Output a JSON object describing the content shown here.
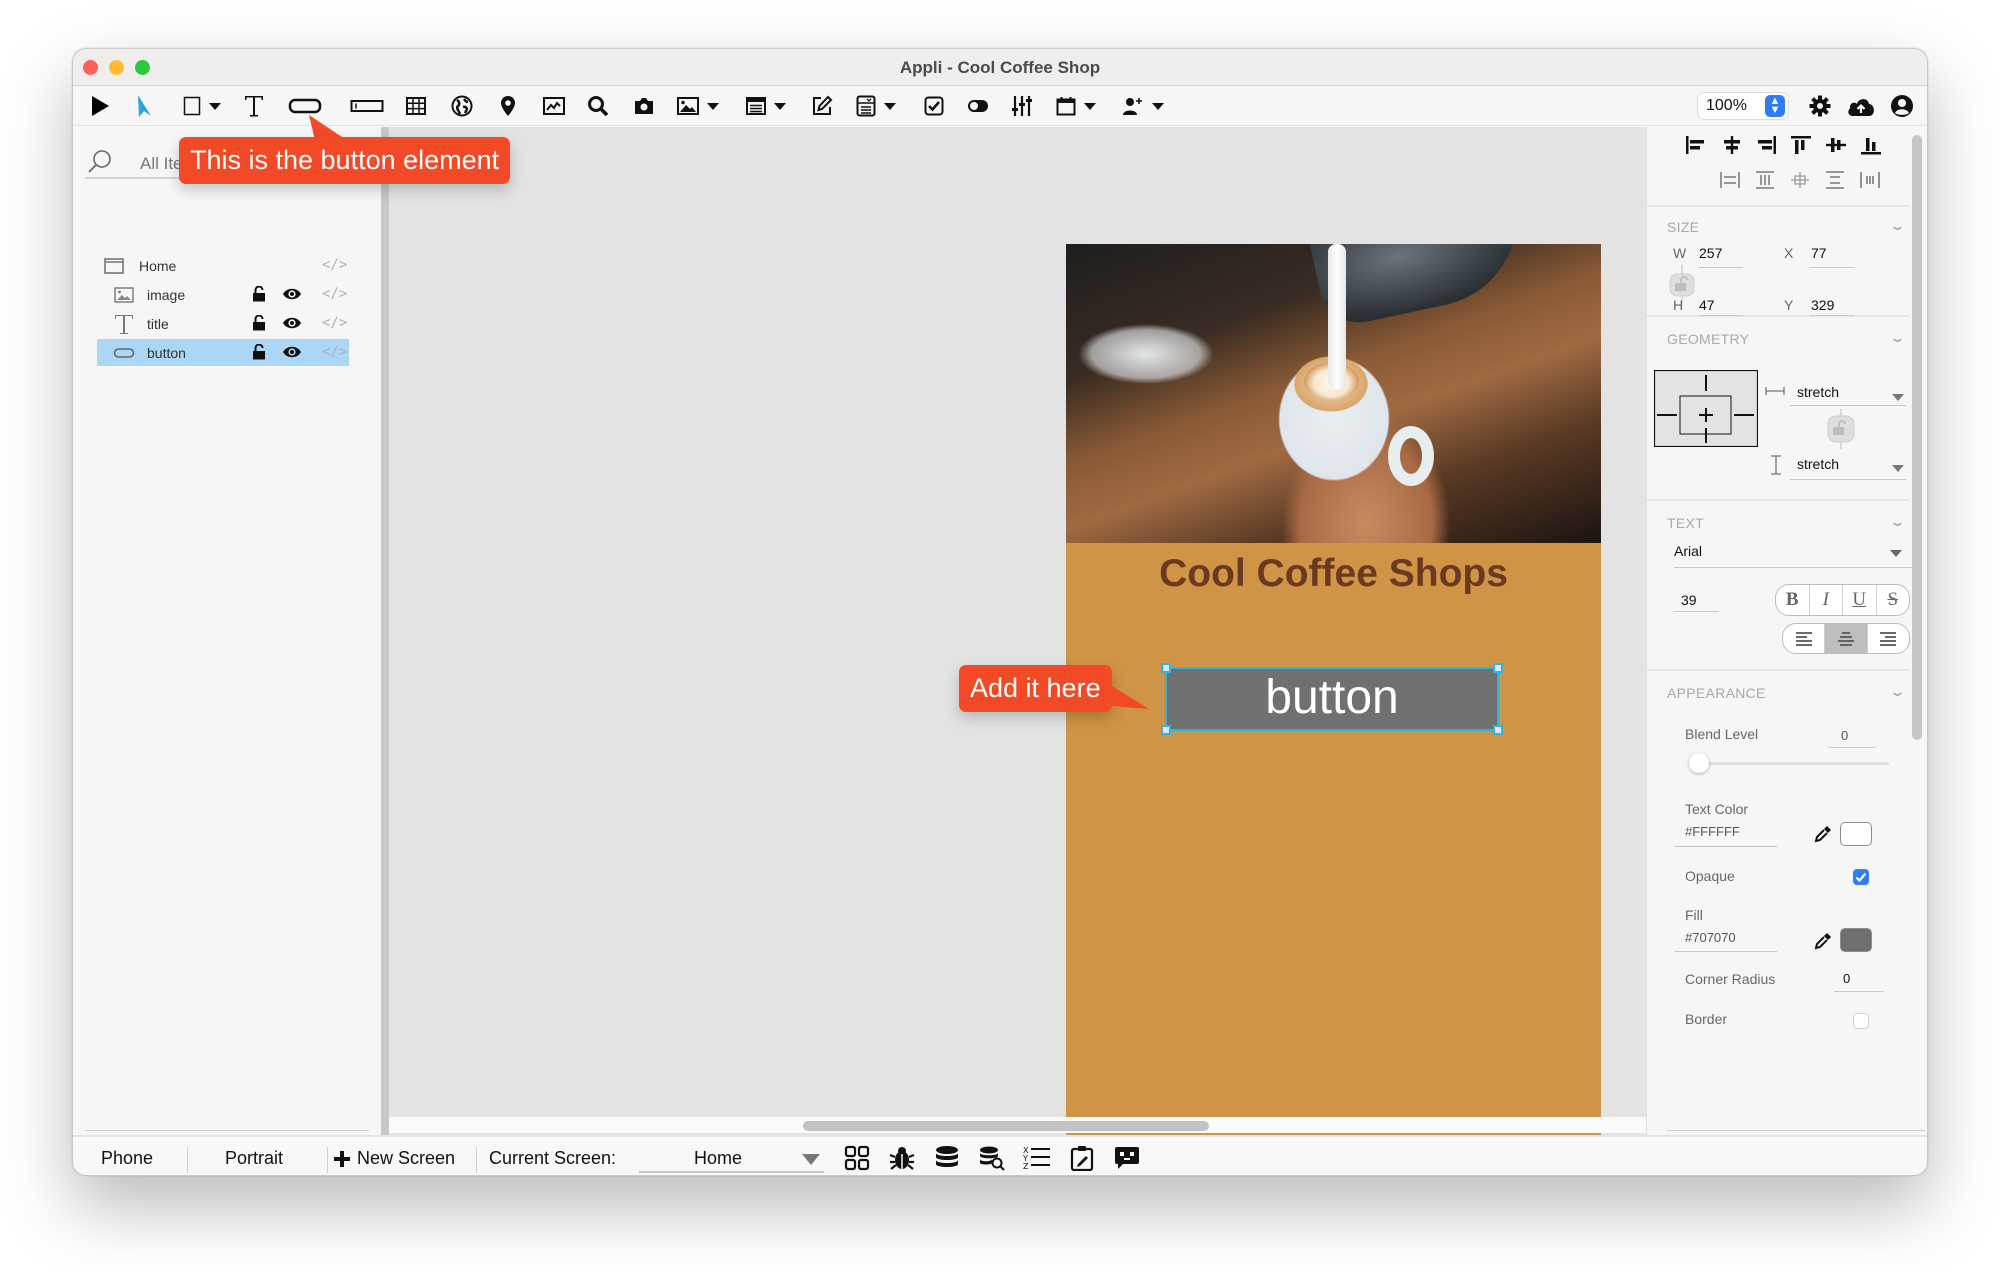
{
  "window": {
    "title": "Appli - Cool Coffee Shop"
  },
  "toolbar": {
    "tools": [
      {
        "icon": "play-icon",
        "label": "Run"
      },
      {
        "icon": "pointer-icon",
        "label": "Select"
      },
      {
        "icon": "rectangle-icon",
        "label": "Shape",
        "has_menu": true
      },
      {
        "icon": "text-icon",
        "label": "Text"
      },
      {
        "icon": "button-element-icon",
        "label": "Button"
      },
      {
        "icon": "text-field-icon",
        "label": "Text Field"
      },
      {
        "icon": "table-icon",
        "label": "Table"
      },
      {
        "icon": "globe-icon",
        "label": "Web View"
      },
      {
        "icon": "map-pin-icon",
        "label": "Map"
      },
      {
        "icon": "chart-icon",
        "label": "Chart"
      },
      {
        "icon": "search-icon",
        "label": "Search"
      },
      {
        "icon": "camera-icon",
        "label": "Camera"
      },
      {
        "icon": "image-icon",
        "label": "Image",
        "has_menu": true
      },
      {
        "icon": "list-icon",
        "label": "List",
        "has_menu": true
      },
      {
        "icon": "edit-icon",
        "label": "Edit"
      },
      {
        "icon": "form-icon",
        "label": "Form",
        "has_menu": true
      },
      {
        "icon": "checkbox-icon",
        "label": "Checkbox"
      },
      {
        "icon": "toggle-icon",
        "label": "Toggle"
      },
      {
        "icon": "sliders-icon",
        "label": "Sliders"
      },
      {
        "icon": "calendar-icon",
        "label": "Calendar",
        "has_menu": true
      },
      {
        "icon": "add-user-icon",
        "label": "Add User",
        "has_menu": true
      }
    ],
    "zoom_level": "100%",
    "right_icons": [
      "settings-icon",
      "cloud-upload-icon",
      "account-icon"
    ]
  },
  "left_panel": {
    "search_placeholder": "All Items",
    "layers": [
      {
        "name": "Home",
        "icon": "screen-icon",
        "level": 0,
        "selected": false,
        "show_controls": false
      },
      {
        "name": "image",
        "icon": "image-icon",
        "level": 1,
        "selected": false,
        "show_controls": true
      },
      {
        "name": "title",
        "icon": "text-icon",
        "level": 1,
        "selected": false,
        "show_controls": true
      },
      {
        "name": "button",
        "icon": "button-element-icon",
        "level": 1,
        "selected": true,
        "show_controls": true
      }
    ],
    "code_glyph": "</>",
    "bottom_tabs": [
      "layers-list-icon",
      "bookmark-icon"
    ]
  },
  "canvas": {
    "phone": {
      "background": "#D09446",
      "image_alt": "latte art being poured into a cup",
      "title_text": "Cool Coffee Shops",
      "title_color": "#6B3920",
      "button_text": "button",
      "button_fill": "#707070",
      "button_text_color": "#FFFFFF",
      "selection_color": "#29B6E8"
    },
    "callouts": {
      "toolbar_hint": "This is the button element",
      "canvas_hint": "Add it here",
      "color": "#F24A26"
    }
  },
  "right_panel": {
    "size": {
      "header": "SIZE",
      "w_label": "W",
      "w_value": "257",
      "h_label": "H",
      "h_value": "47",
      "x_label": "X",
      "x_value": "77",
      "y_label": "Y",
      "y_value": "329"
    },
    "geometry": {
      "header": "GEOMETRY",
      "horizontal": "stretch",
      "vertical": "stretch"
    },
    "text": {
      "header": "TEXT",
      "font": "Arial",
      "size": "39",
      "styles": [
        "B",
        "I",
        "U",
        "S"
      ],
      "alignment": [
        "left",
        "center",
        "right"
      ],
      "active_alignment": "center"
    },
    "appearance": {
      "header": "APPEARANCE",
      "blend_label": "Blend Level",
      "blend_value": "0",
      "blend_fraction": 0,
      "text_color_label": "Text Color",
      "text_color_value": "#FFFFFF",
      "opaque_label": "Opaque",
      "opaque_checked": true,
      "fill_label": "Fill",
      "fill_value": "#707070",
      "corner_radius_label": "Corner Radius",
      "corner_radius_value": "0",
      "border_label": "Border",
      "border_checked": false
    },
    "footer_icons": [
      "disabled-icon",
      "code-icon"
    ]
  },
  "bottom_bar": {
    "device": "Phone",
    "orientation": "Portrait",
    "new_screen": "New Screen",
    "current_screen_label": "Current Screen:",
    "current_screen": "Home",
    "icons": [
      "grid-icon",
      "bug-icon",
      "database-icon",
      "database-search-icon",
      "xyz-list-icon",
      "clipboard-edit-icon",
      "chat-bot-icon"
    ]
  },
  "colors": {
    "accent_blue": "#2F7CF6",
    "selection_row": "#ACD6F6",
    "pointer_blue": "#2AA3E0"
  }
}
